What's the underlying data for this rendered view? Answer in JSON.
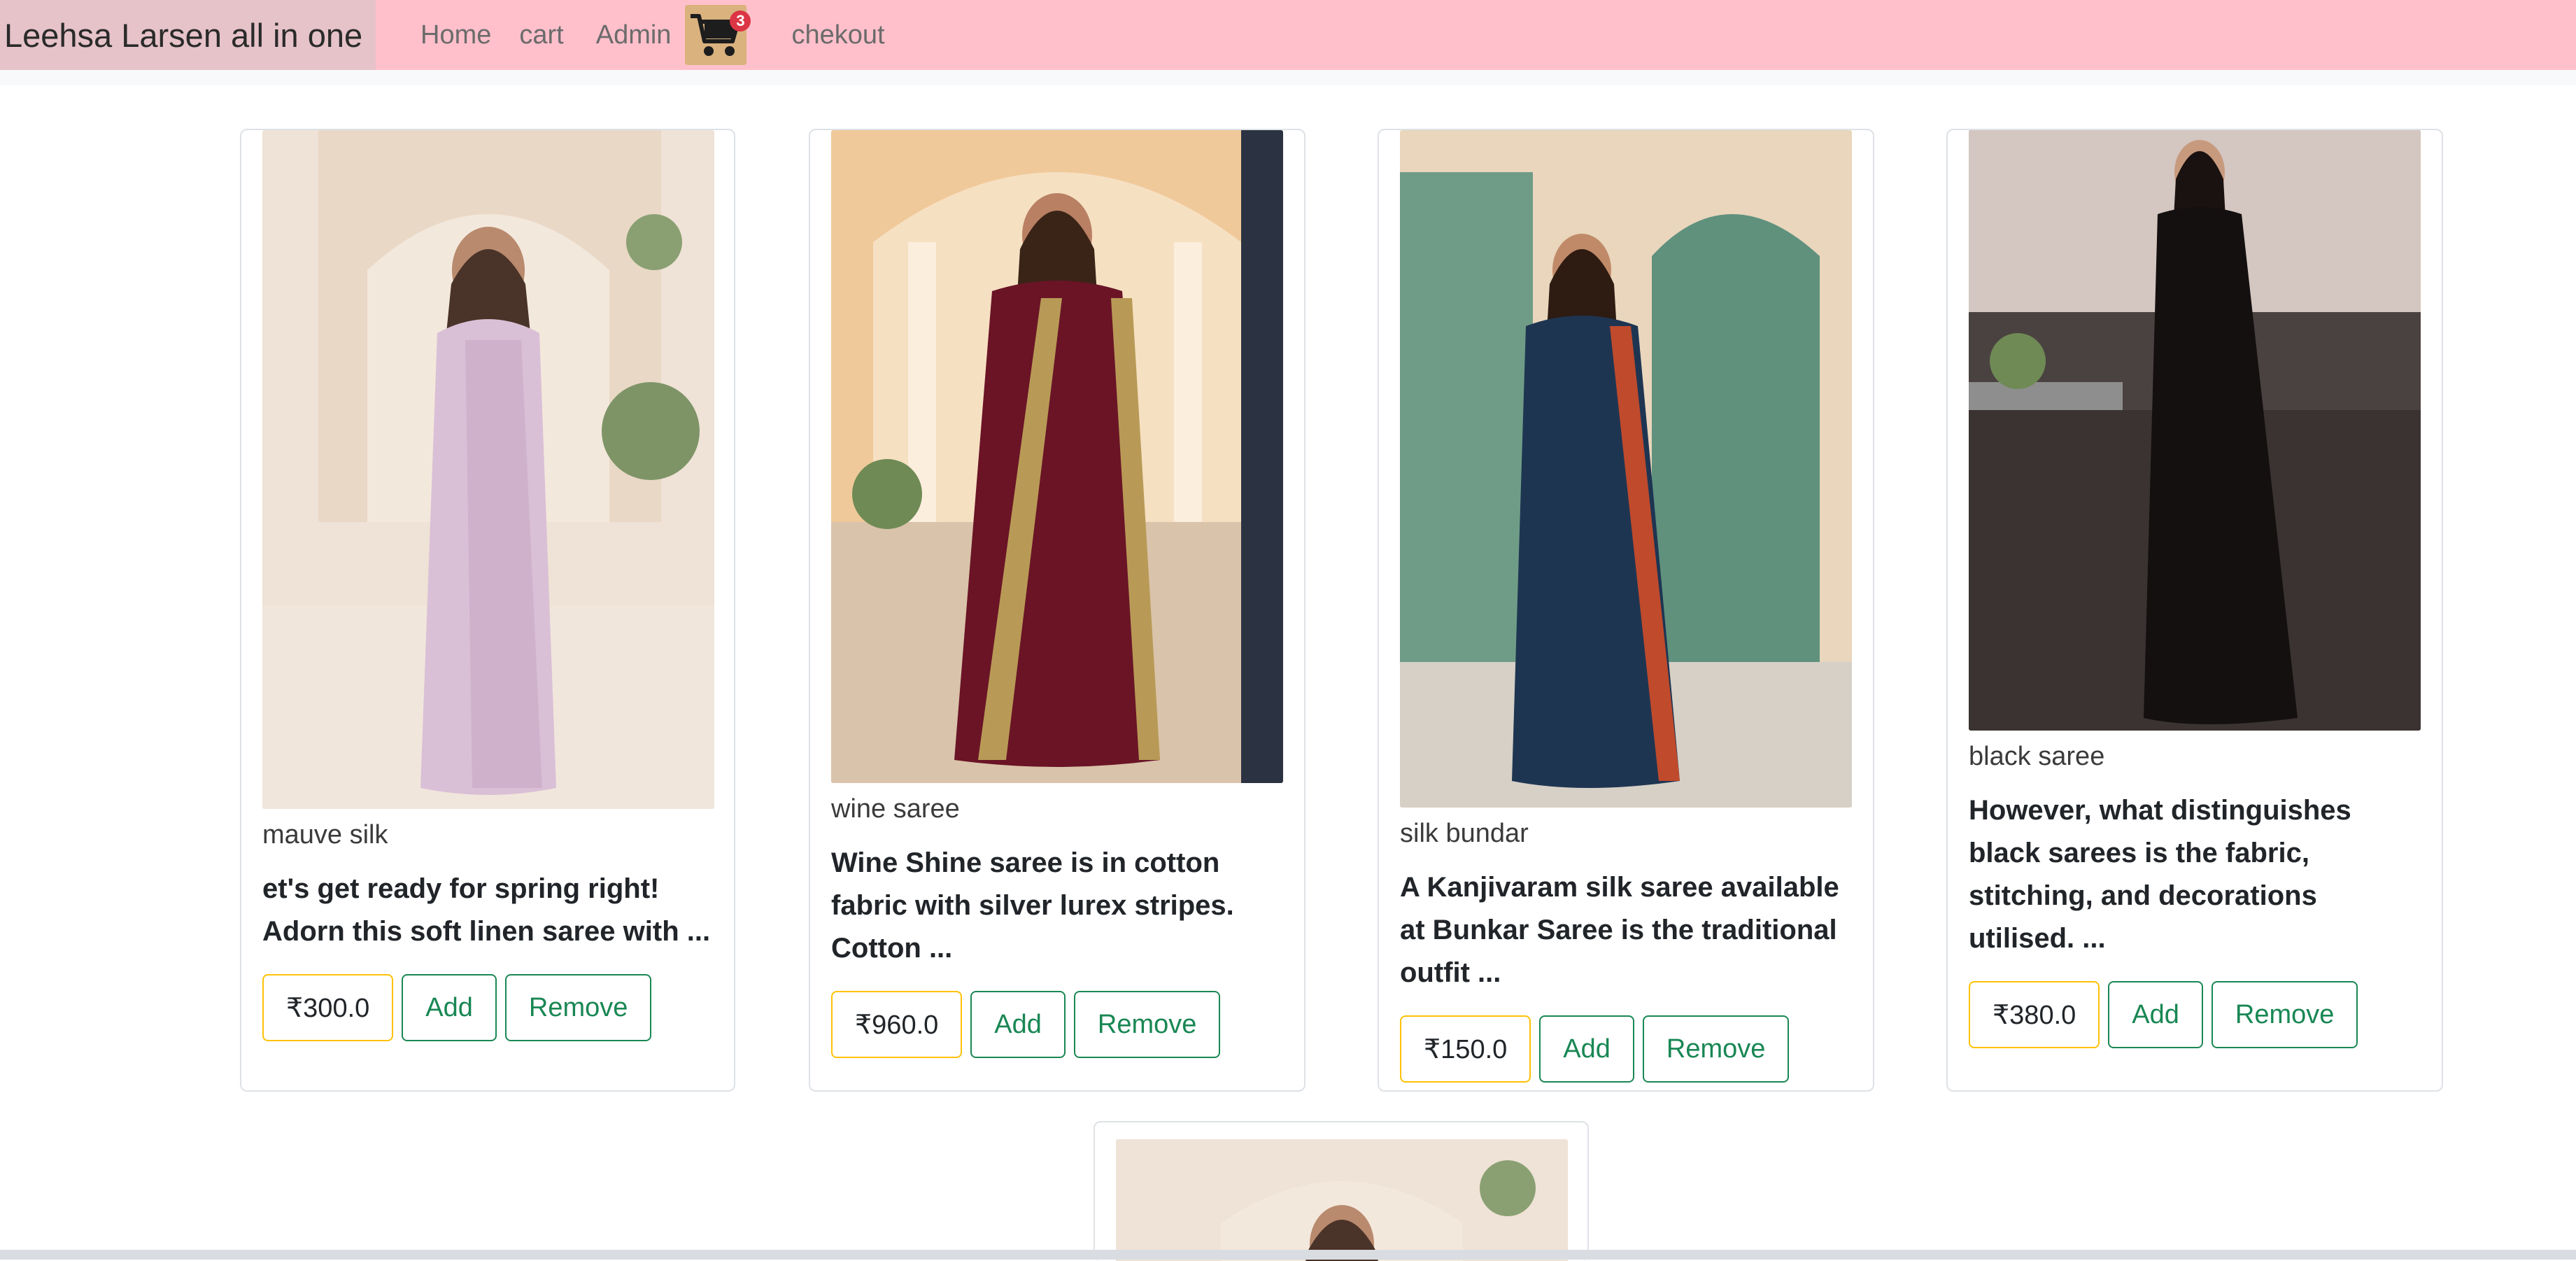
{
  "navbar": {
    "brand": "Leehsa Larsen all in one",
    "links": {
      "home": "Home",
      "cart": "cart",
      "admin": "Admin",
      "checkout": "chekout"
    },
    "cart_badge": "3"
  },
  "products": [
    {
      "name": "mauve silk",
      "description": "et's get ready for spring right! Adorn this soft linen saree with ...",
      "price": "₹300.0",
      "add_label": "Add",
      "remove_label": "Remove"
    },
    {
      "name": "wine saree",
      "description": "Wine Shine saree is in cotton fabric with silver lurex stripes. Cotton ...",
      "price": "₹960.0",
      "add_label": "Add",
      "remove_label": "Remove"
    },
    {
      "name": "silk bundar",
      "description": "A Kanjivaram silk saree available at Bunkar Saree is the traditional outfit ...",
      "price": "₹150.0",
      "add_label": "Add",
      "remove_label": "Remove"
    },
    {
      "name": "black saree",
      "description": "However, what distinguishes black sarees is the fabric, stitching, and decorations utilised. ...",
      "price": "₹380.0",
      "add_label": "Add",
      "remove_label": "Remove"
    }
  ],
  "colors": {
    "navbar": "#ffc0cb",
    "brand_bg": "#e6c3c9",
    "price_border": "#ffc107",
    "action_green": "#198754"
  }
}
